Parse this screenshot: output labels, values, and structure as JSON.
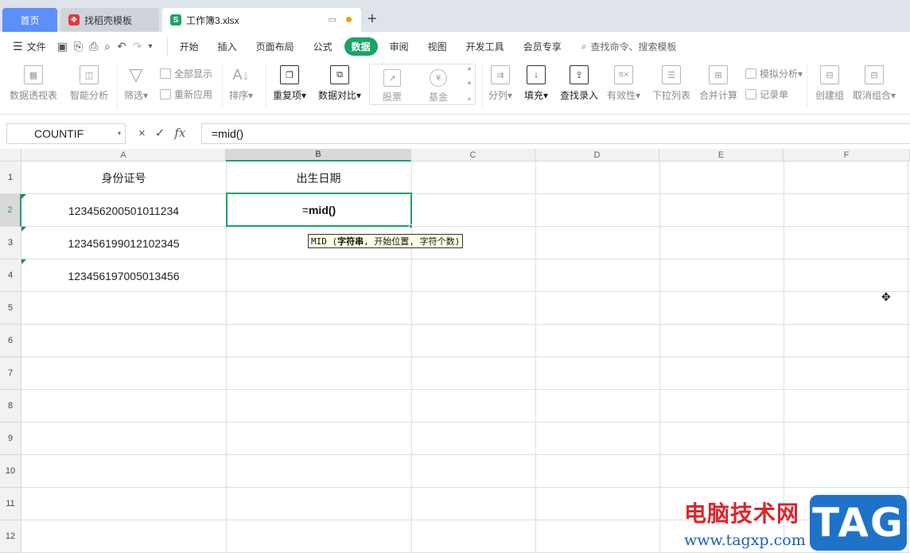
{
  "tabs": {
    "home": "首页",
    "template": "找稻壳模板",
    "file": "工作簿3.xlsx",
    "new_tab": "+"
  },
  "menu": {
    "file": "文件",
    "items": [
      "开始",
      "插入",
      "页面布局",
      "公式",
      "数据",
      "审阅",
      "视图",
      "开发工具",
      "会员专享"
    ],
    "active": "数据",
    "search": "查找命令、搜索模板"
  },
  "ribbon": {
    "pivot": "数据透视表",
    "smart": "智能分析",
    "filter": "筛选",
    "show_all": "全部显示",
    "reapply": "重新应用",
    "sort": "排序",
    "duplicate": "重复项",
    "compare": "数据对比",
    "stock": "股票",
    "fund": "基金",
    "split": "分列",
    "fill": "填充",
    "lookup": "查找录入",
    "validity": "有效性",
    "dropdown": "下拉列表",
    "consolidate": "合并计算",
    "simulate": "模拟分析",
    "record": "记录单",
    "group": "创建组",
    "ungroup": "取消组合"
  },
  "formula_bar": {
    "name_box": "COUNTIF",
    "cancel": "×",
    "confirm": "✓",
    "fx": "fx",
    "formula": "=mid()"
  },
  "grid": {
    "columns": [
      "A",
      "B",
      "C",
      "D",
      "E",
      "F"
    ],
    "rows": [
      "1",
      "2",
      "3",
      "4",
      "5",
      "6",
      "7",
      "8",
      "9",
      "10",
      "11",
      "12"
    ],
    "header_a1": "身份证号",
    "header_b1": "出生日期",
    "ids": [
      "123456200501011234",
      "123456199012102345",
      "123456197005013456"
    ],
    "active_cell_eq": "=",
    "active_cell_fn": "mid()",
    "tooltip_fn": "MID (",
    "tooltip_arg_bold": "字符串",
    "tooltip_rest": ", 开始位置, 字符个数)"
  },
  "watermark": {
    "site": "电脑技术网",
    "url": "www.tagxp.com",
    "tag": "TAG"
  }
}
